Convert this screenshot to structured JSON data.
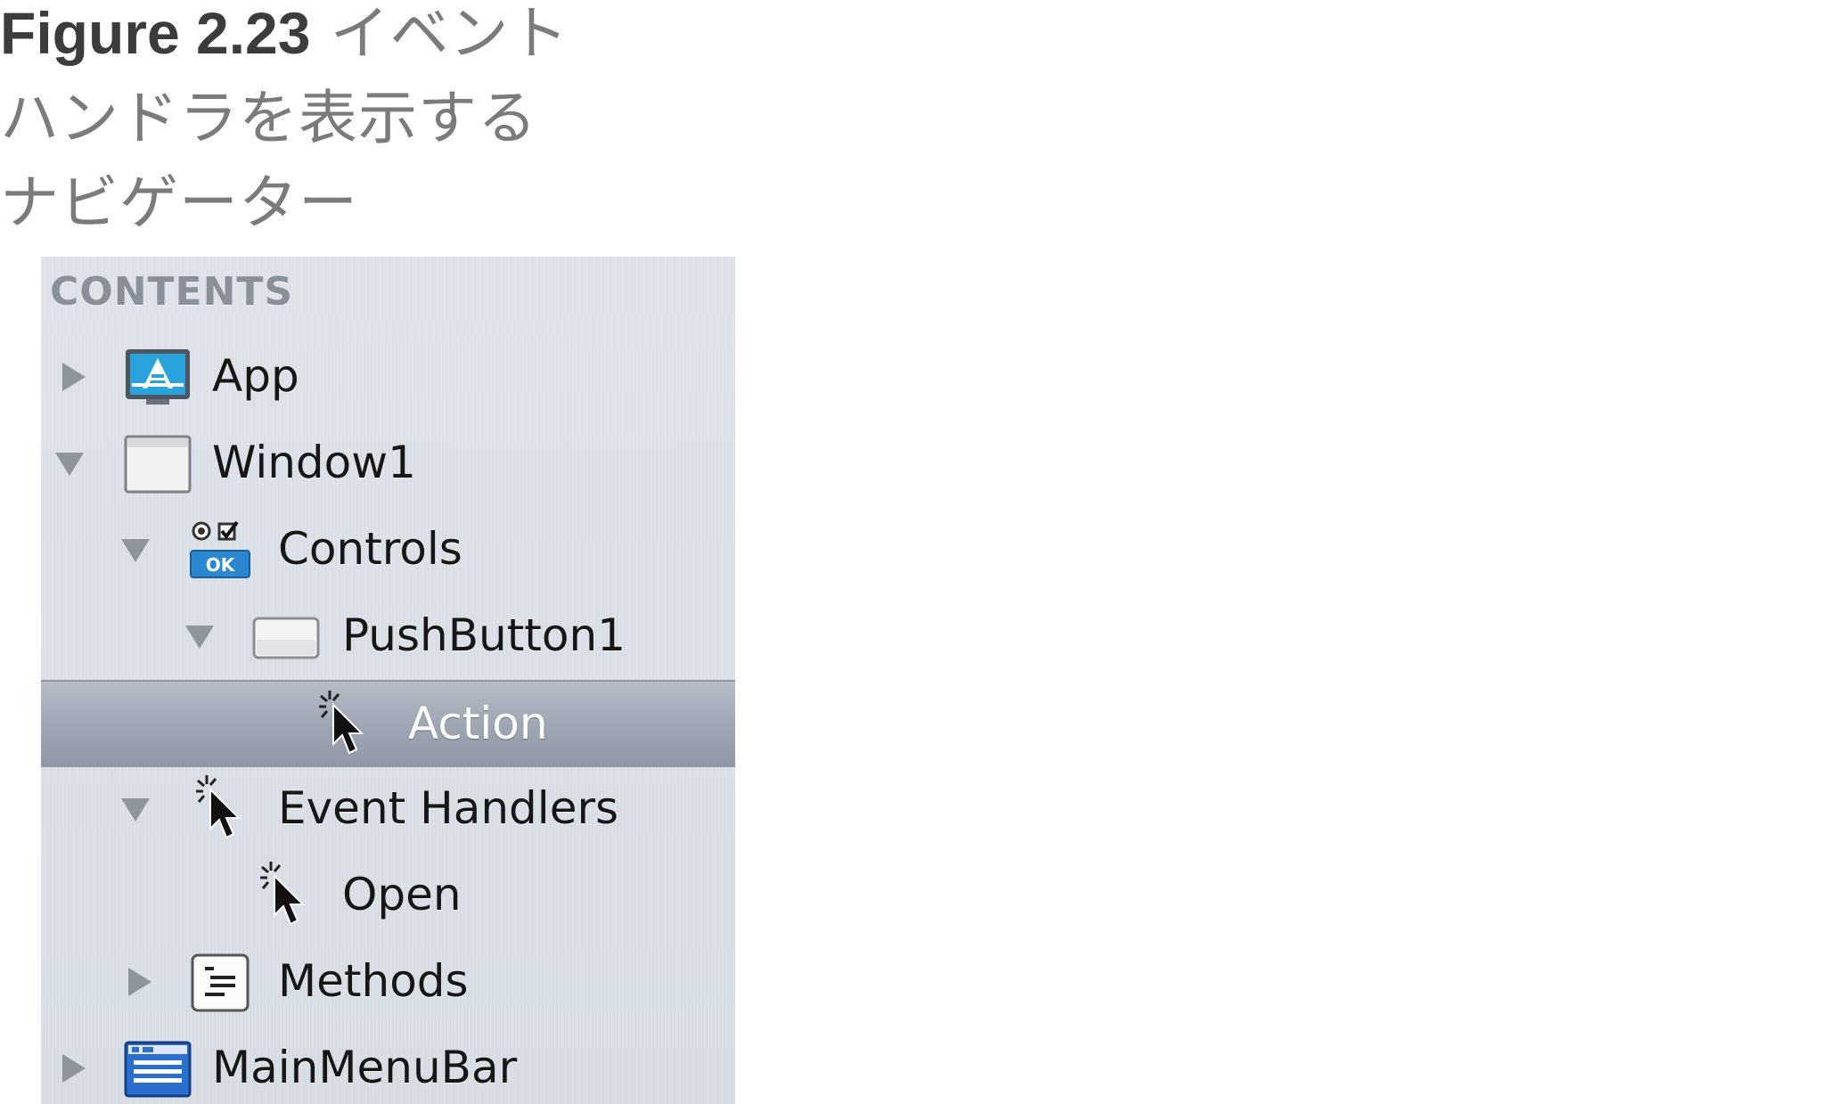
{
  "caption": {
    "figure_number": "Figure 2.23",
    "line1": "イベント",
    "line2": "ハンドラを表示する",
    "line3": "ナビゲーター"
  },
  "navigator": {
    "header": "CONTENTS",
    "items": [
      {
        "label": "App",
        "depth": 0,
        "disclosure": "collapsed",
        "icon": "app-icon",
        "selected": false
      },
      {
        "label": "Window1",
        "depth": 0,
        "disclosure": "expanded",
        "icon": "window-icon",
        "selected": false
      },
      {
        "label": "Controls",
        "depth": 1,
        "disclosure": "expanded",
        "icon": "controls-icon",
        "selected": false
      },
      {
        "label": "PushButton1",
        "depth": 2,
        "disclosure": "expanded",
        "icon": "pushbutton-icon",
        "selected": false
      },
      {
        "label": "Action",
        "depth": 3,
        "disclosure": "none",
        "icon": "event-cursor-icon",
        "selected": true
      },
      {
        "label": "Event Handlers",
        "depth": 1,
        "disclosure": "expanded",
        "icon": "event-cursor-icon",
        "selected": false
      },
      {
        "label": "Open",
        "depth": 2,
        "disclosure": "none",
        "icon": "event-cursor-icon",
        "selected": false
      },
      {
        "label": "Methods",
        "depth": 1,
        "disclosure": "collapsed",
        "icon": "methods-icon",
        "selected": false
      },
      {
        "label": "MainMenuBar",
        "depth": 0,
        "disclosure": "collapsed",
        "icon": "menubar-icon",
        "selected": false
      }
    ]
  },
  "colors": {
    "selected_row": "#9ea5b2",
    "panel_background": "#dbe0e8",
    "disclosure_triangle": "#8f959d",
    "caption_text": "#7b7b7b"
  }
}
